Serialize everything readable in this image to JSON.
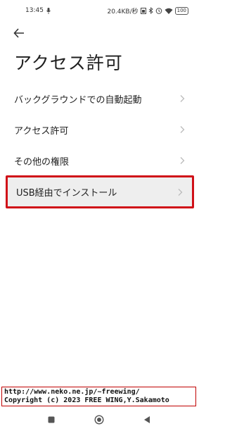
{
  "status_bar": {
    "time": "13:45",
    "network_speed": "20.4KB/秒",
    "battery": "100",
    "icons": [
      "mic-icon",
      "sim-icon",
      "bluetooth-icon",
      "alarm-icon",
      "wifi-icon",
      "battery-icon"
    ]
  },
  "header": {
    "back_icon": "arrow-left-icon",
    "title": "アクセス許可"
  },
  "menu": {
    "items": [
      {
        "label": "バックグラウンドでの自動起動"
      },
      {
        "label": "アクセス許可"
      },
      {
        "label": "その他の権限"
      },
      {
        "label": "USB経由でインストール",
        "highlighted": true
      }
    ]
  },
  "watermark": {
    "line1": "http://www.neko.ne.jp/~freewing/",
    "line2": "Copyright (c) 2023 FREE WING,Y.Sakamoto"
  },
  "nav_bar": {
    "icons": [
      "recents-square-icon",
      "home-circle-icon",
      "back-triangle-icon"
    ]
  },
  "colors": {
    "highlight_border": "#d01018",
    "highlight_fill": "#eeeeee",
    "text": "#222222"
  }
}
